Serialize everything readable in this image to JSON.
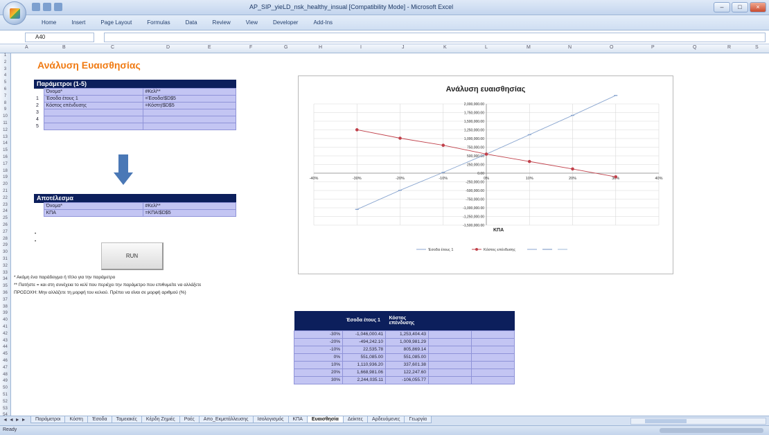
{
  "colors": {
    "accent": "#f07a12",
    "header_bg": "#0c1f5c",
    "cell_bg": "#c3c5f3",
    "series1": "#8aa6d0",
    "series2": "#c0404a"
  },
  "window": {
    "title": "AP_SIP_yieLD_nsk_healthy_insual [Compatibility Mode] - Microsoft Excel"
  },
  "ribbon": {
    "tabs": [
      "Home",
      "Insert",
      "Page Layout",
      "Formulas",
      "Data",
      "Review",
      "View",
      "Developer",
      "Add-Ins"
    ]
  },
  "formula_bar": {
    "name_box": "A40"
  },
  "sheet": {
    "title": "Ανάλυση Ευαισθησίας"
  },
  "params": {
    "header": "Παράμετροι (1-5)",
    "col1": "Όνομα*",
    "col2": "#Κελί**",
    "rows": [
      {
        "num": "1",
        "name": "Έσοδα έτους 1",
        "cell": "=Έσοδα!$D$5"
      },
      {
        "num": "2",
        "name": "Κόστος επένδυσης",
        "cell": "=Κόστη!$D$5"
      },
      {
        "num": "3",
        "name": "",
        "cell": ""
      },
      {
        "num": "4",
        "name": "",
        "cell": ""
      },
      {
        "num": "5",
        "name": "",
        "cell": ""
      }
    ]
  },
  "result": {
    "header": "Αποτέλεσμα",
    "col1": "Όνομα*",
    "col2": "#Κελί**",
    "row_name": "ΚΠΑ",
    "row_cell": "=ΚΠΑ!$D$5"
  },
  "run_button": {
    "label": "RUN"
  },
  "notes": {
    "n1": "* Ακόμη ένα παράδειγμα ή τίτλο για την παράμετρο",
    "n2": "** Πατήστε = και στη συνέχεια το κελί που περιέχει την παράμετρο που επιθυμείτε να αλλάξετε",
    "n3": "ΠΡΟΣΟΧΗ: Μην αλλάζετε τη μορφή του κελιού. Πρέπει να είναι σε μορφή αριθμού (%)"
  },
  "chart_data": {
    "type": "line",
    "title": "Ανάλυση ευαισθησίας",
    "xlabel": "ΚΠΑ",
    "ylabel": "",
    "x": [
      -0.3,
      -0.2,
      -0.1,
      0.0,
      0.1,
      0.2,
      0.3
    ],
    "xlim": [
      -0.4,
      0.4
    ],
    "ylim": [
      -1500000,
      2000000
    ],
    "y_step": 250000,
    "x_ticks": [
      "-40%",
      "-30%",
      "-20%",
      "-10%",
      "0%",
      "10%",
      "20%",
      "30%",
      "40%"
    ],
    "y_ticks": [
      "2,000,000.00",
      "1,750,000.00",
      "1,500,000.00",
      "1,250,000.00",
      "1,000,000.00",
      "750,000.00",
      "500,000.00",
      "250,000.00",
      "0.00",
      "-250,000.00",
      "-500,000.00",
      "-750,000.00",
      "-1,000,000.00",
      "-1,250,000.00",
      "-1,500,000.00"
    ],
    "grid": true,
    "legend": "bottom",
    "series": [
      {
        "name": "Έσοδα έτους 1",
        "color": "#8aa6d0",
        "marker": "dash",
        "values": [
          -1046000,
          -494242,
          22535,
          551085,
          1110936,
          1668981,
          2244035
        ]
      },
      {
        "name": "Κόστος επένδυσης",
        "color": "#c0404a",
        "marker": "circle",
        "values": [
          1253404,
          1009981,
          805869,
          551085,
          337601,
          122247,
          -106055
        ]
      }
    ]
  },
  "results_table": {
    "headers": [
      "",
      "Έσοδα έτους 1",
      "Κόστος επένδυσης",
      "",
      ""
    ],
    "rows": [
      [
        "-30%",
        "-1,046,000.41",
        "1,253,404.43",
        "",
        ""
      ],
      [
        "-20%",
        "-494,242.10",
        "1,009,981.29",
        "",
        ""
      ],
      [
        "-10%",
        "22,535.78",
        "805,869.14",
        "",
        ""
      ],
      [
        "0%",
        "551,085.00",
        "551,085.00",
        "",
        ""
      ],
      [
        "10%",
        "1,110,936.20",
        "337,601.38",
        "",
        ""
      ],
      [
        "20%",
        "1,668,981.06",
        "122,247.60",
        "",
        ""
      ],
      [
        "30%",
        "2,244,035.11",
        "-106,055.77",
        "",
        ""
      ]
    ]
  },
  "sheet_tabs": {
    "nav": "◄ ◄ ► ►",
    "tabs": [
      "Παράμετροι",
      "Κόστη",
      "Έσοδα",
      "Ταμειακές",
      "Κέρδη Ζημιές",
      "Ροές",
      "Απο_Εκμετάλλευσης",
      "Ισολογισμός",
      "ΚΠΑ",
      "Ευαισθησία",
      "Δείκτες",
      "Αρδευόμενες",
      "Γεωργία"
    ],
    "active": "Ευαισθησία"
  },
  "status": {
    "ready": "Ready"
  }
}
